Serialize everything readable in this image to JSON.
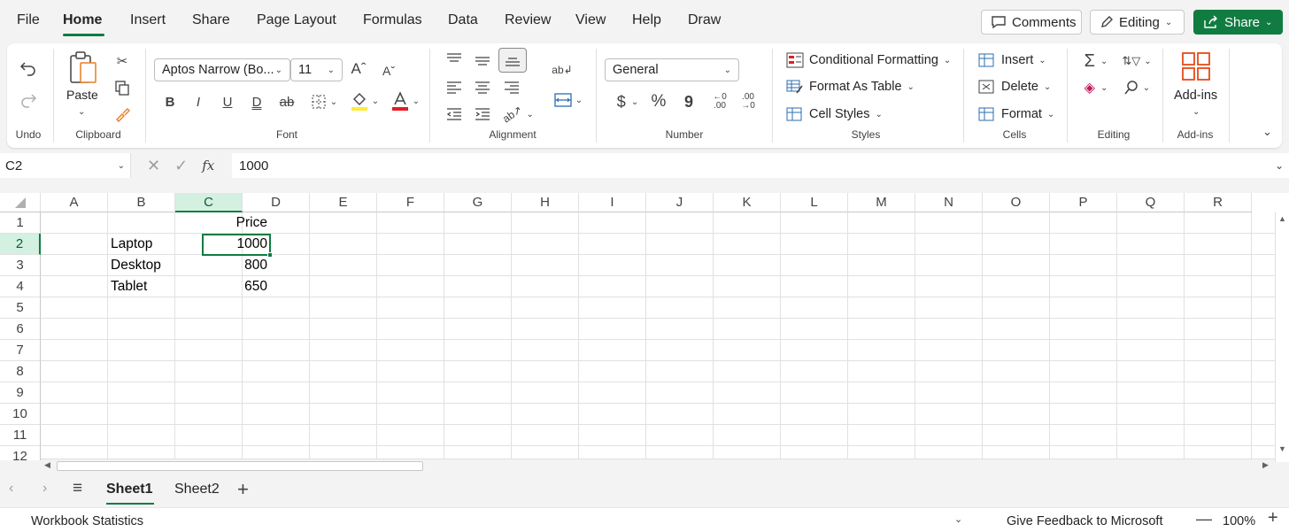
{
  "menu": {
    "tabs": [
      "File",
      "Home",
      "Insert",
      "Share",
      "Page Layout",
      "Formulas",
      "Data",
      "Review",
      "View",
      "Help",
      "Draw"
    ],
    "active": "Home",
    "comments_label": "Comments",
    "editing_label": "Editing",
    "share_label": "Share"
  },
  "ribbon": {
    "undo_group": "Undo",
    "paste_label": "Paste",
    "clipboard_group": "Clipboard",
    "font_name": "Aptos Narrow (Bo...",
    "font_size": "11",
    "font_group": "Font",
    "bold": "B",
    "italic": "I",
    "underline": "U",
    "double_underline": "D",
    "strike": "ab",
    "alignment_group": "Alignment",
    "number_format": "General",
    "currency": "$",
    "percent": "%",
    "comma": "9",
    "inc_decimal": ".00",
    "dec_decimal": ".00",
    "number_group": "Number",
    "conditional_formatting": "Conditional Formatting",
    "format_as_table": "Format As Table",
    "cell_styles": "Cell Styles",
    "styles_group": "Styles",
    "insert": "Insert",
    "delete": "Delete",
    "format": "Format",
    "cells_group": "Cells",
    "editing_group": "Editing",
    "addins_label": "Add-ins",
    "addins_group": "Add-ins"
  },
  "formula_bar": {
    "name_box": "C2",
    "fx": "fx",
    "value": "1000"
  },
  "grid": {
    "columns": [
      "A",
      "B",
      "C",
      "D",
      "E",
      "F",
      "G",
      "H",
      "I",
      "J",
      "K",
      "L",
      "M",
      "N",
      "O",
      "P",
      "Q",
      "R"
    ],
    "rows": [
      "1",
      "2",
      "3",
      "4",
      "5",
      "6",
      "7",
      "8",
      "9",
      "10",
      "11",
      "12"
    ],
    "selected_column": "C",
    "selected_row": "2",
    "cells": {
      "C1": "Price",
      "B2": "Laptop",
      "C2": "1000",
      "B3": "Desktop",
      "C3": "800",
      "B4": "Tablet",
      "C4": "650"
    }
  },
  "sheets": {
    "tabs": [
      "Sheet1",
      "Sheet2"
    ],
    "active": "Sheet1"
  },
  "status": {
    "workbook_statistics": "Workbook Statistics",
    "feedback": "Give Feedback to Microsoft",
    "zoom": "100%"
  },
  "colors": {
    "accent": "#107c41",
    "selected_header_bg": "#d3f0e0"
  }
}
